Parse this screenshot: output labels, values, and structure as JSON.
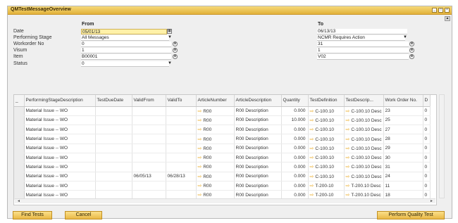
{
  "window": {
    "title": "QMTestMessageOverview"
  },
  "colors": {
    "titlebar": "#e2b13a",
    "button": "#f0c55c",
    "highlight_field": "#fff1a8",
    "arrow": "#e8a71c"
  },
  "icons": {
    "calendar": "calendar-icon",
    "lookup": "lookup-icon",
    "link_arrow": "link-arrow-icon"
  },
  "filter": {
    "from_header": "From",
    "to_header": "To",
    "labels": [
      "Date",
      "Performing Stage",
      "Workorder No",
      "Visum",
      "Item",
      "Status"
    ],
    "from": {
      "date": "05/01/13",
      "performing_stage": "All Messages",
      "workorder_no": "0",
      "visum": "1",
      "item": "B00001",
      "status": "0"
    },
    "to": {
      "date": "06/13/13",
      "performing_stage": "NCMR Requires Action",
      "workorder_no": "31",
      "visum": "1",
      "item": "V02"
    }
  },
  "grid": {
    "corner": "_",
    "columns": [
      "PerformingStageDescription",
      "TestDueDate",
      "ValidFrom",
      "ValidTo",
      "ArticleNumber",
      "ArticleDescription",
      "Quantity",
      "TestDefinition",
      "TestDescrip...",
      "Work Order No.",
      "D"
    ],
    "rows": [
      [
        "Material Issue -- WO",
        "",
        "",
        "",
        "R00",
        "R00 Description",
        "0.000",
        "C-100.10",
        "C-100.10 Desc",
        "23",
        "0"
      ],
      [
        "Material Issue -- WO",
        "",
        "",
        "",
        "R00",
        "R00 Description",
        "10.000",
        "C-100.10",
        "C-100.10 Desc",
        "25",
        "0"
      ],
      [
        "Material Issue -- WO",
        "",
        "",
        "",
        "R00",
        "R00 Description",
        "0.000",
        "C-100.10",
        "C-100.10 Desc",
        "27",
        "0"
      ],
      [
        "Material Issue -- WO",
        "",
        "",
        "",
        "R00",
        "R00 Description",
        "0.000",
        "C-100.10",
        "C-100.10 Desc",
        "28",
        "0"
      ],
      [
        "Material Issue -- WO",
        "",
        "",
        "",
        "R00",
        "R00 Description",
        "0.000",
        "C-100.10",
        "C-100.10 Desc",
        "29",
        "0"
      ],
      [
        "Material Issue -- WO",
        "",
        "",
        "",
        "R00",
        "R00 Description",
        "0.000",
        "C-100.10",
        "C-100.10 Desc",
        "30",
        "0"
      ],
      [
        "Material Issue -- WO",
        "",
        "",
        "",
        "R00",
        "R00 Description",
        "0.000",
        "C-100.10",
        "C-100.10 Desc",
        "31",
        "0"
      ],
      [
        "Material Issue -- WO",
        "",
        "06/05/13",
        "06/28/13",
        "R00",
        "R00 Description",
        "0.000",
        "C-100.10",
        "C-100.10 Desc",
        "24",
        "0"
      ],
      [
        "Material Issue -- WO",
        "",
        "",
        "",
        "R00",
        "R00 Description",
        "0.000",
        "T-200-10",
        "T-200.10 Desc",
        "11",
        "0"
      ],
      [
        "Material Issue -- WO",
        "",
        "",
        "",
        "R00",
        "R00 Description",
        "0.000",
        "T-200-10",
        "T-200.10 Desc",
        "18",
        "0"
      ]
    ]
  },
  "buttons": {
    "find_tests": "Find Tests",
    "cancel": "Cancel",
    "perform_quality_test": "Perform Quality Test"
  }
}
